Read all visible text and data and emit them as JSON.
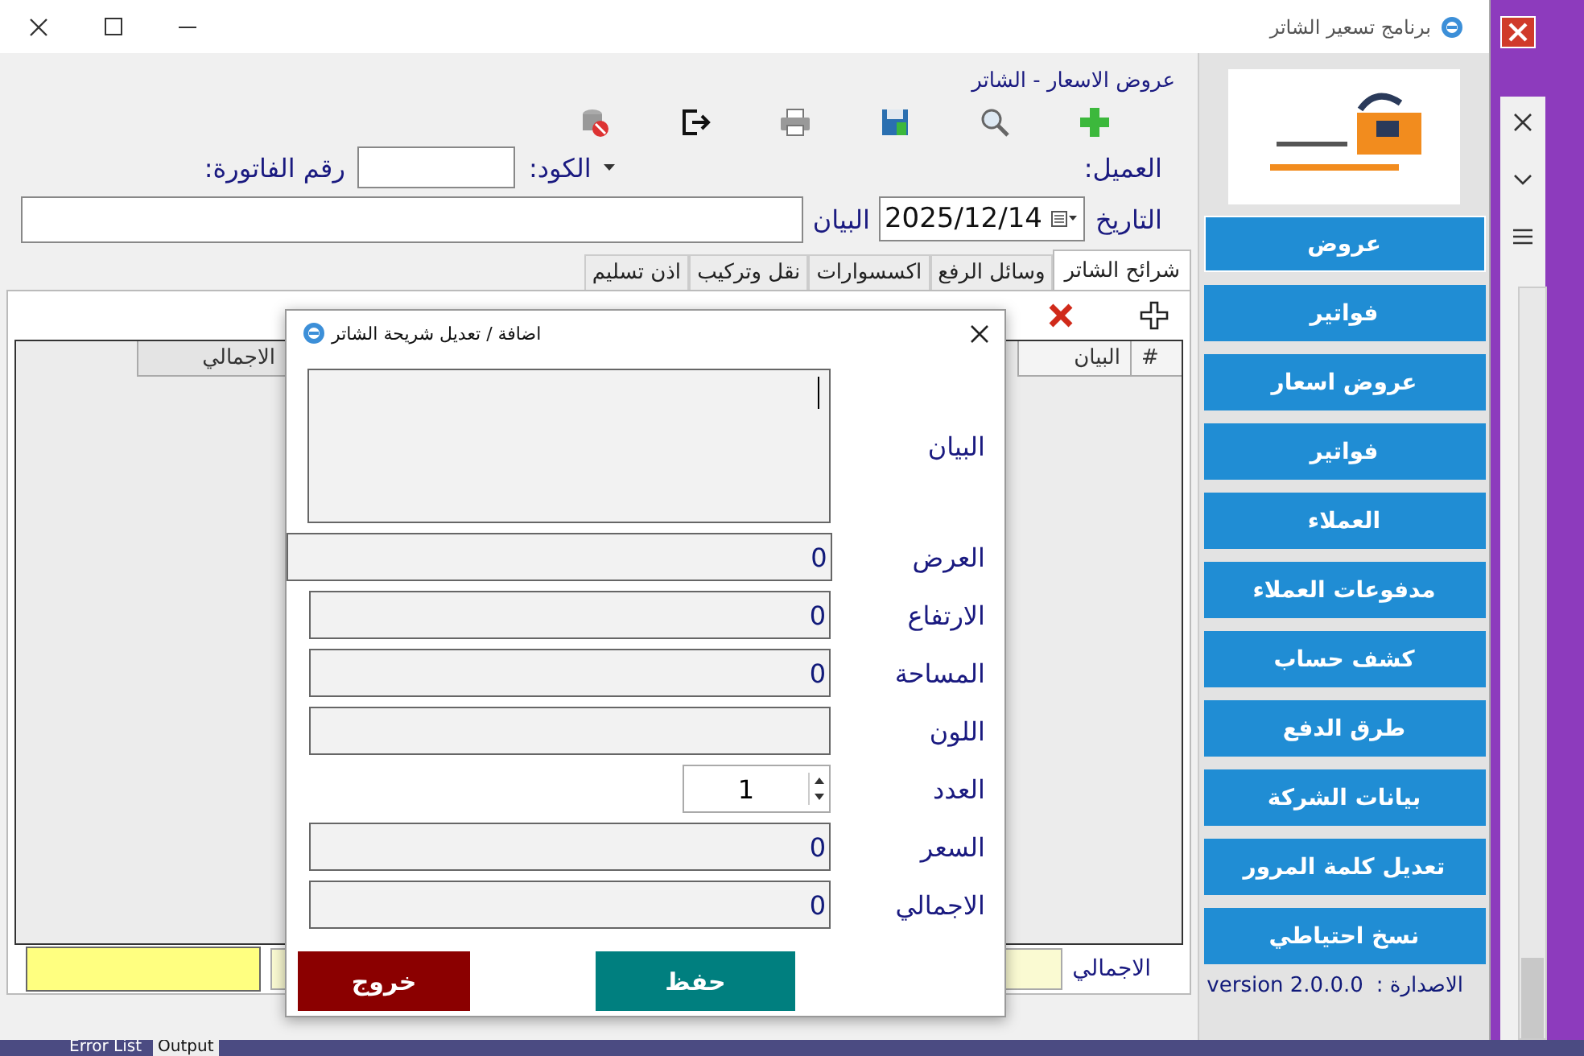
{
  "window": {
    "title": "برنامج تسعير الشاتر"
  },
  "form": {
    "title": "عروض الاسعار - الشاتر",
    "customer_label": "العميل:",
    "code_label": "الكود:",
    "invoice_label": "رقم الفاتورة:",
    "date_label": "التاريخ",
    "date": "2025/12/14",
    "description_label": "البيان"
  },
  "tabs": [
    {
      "label": "شرائح الشاتر",
      "selected": true
    },
    {
      "label": "وسائل الرفع",
      "selected": false
    },
    {
      "label": "اكسسوارات",
      "selected": false
    },
    {
      "label": "نقل وتركيب",
      "selected": false
    },
    {
      "label": "اذن تسليم",
      "selected": false
    }
  ],
  "grid": {
    "columns": [
      "#",
      "البيان",
      "الاجمالي"
    ]
  },
  "totals": {
    "label": "الاجمالي"
  },
  "sidebar": {
    "buttons": [
      "عروض",
      "فواتير",
      "عروض اسعار",
      "فواتير",
      "العملاء",
      "مدفوعات العملاء",
      "كشف حساب",
      "طرق الدفع",
      "بيانات الشركة",
      "تعديل كلمة المرور",
      "نسخ احتياطي"
    ],
    "version_label": "الاصدارة :",
    "version": "version 2.0.0.0"
  },
  "dialog": {
    "title": "اضافة / تعديل شريحة الشاتر",
    "fields": [
      {
        "label": "البيان",
        "kind": "textarea"
      },
      {
        "label": "العرض",
        "kind": "text",
        "value": "0"
      },
      {
        "label": "الارتفاع",
        "kind": "text",
        "value": "0"
      },
      {
        "label": "المساحة",
        "kind": "text",
        "value": "0"
      },
      {
        "label": "اللون",
        "kind": "text"
      },
      {
        "label": "العدد",
        "kind": "spin",
        "value": "1"
      },
      {
        "label": "السعر",
        "kind": "text",
        "value": "0"
      },
      {
        "label": "الاجمالي",
        "kind": "text",
        "value": "0"
      }
    ],
    "buttons": [
      {
        "label": "حفظ",
        "kind": "save"
      },
      {
        "label": "خروج",
        "kind": "exit"
      }
    ]
  },
  "taskbar": {
    "tabs": [
      "Output",
      "Error List"
    ]
  }
}
